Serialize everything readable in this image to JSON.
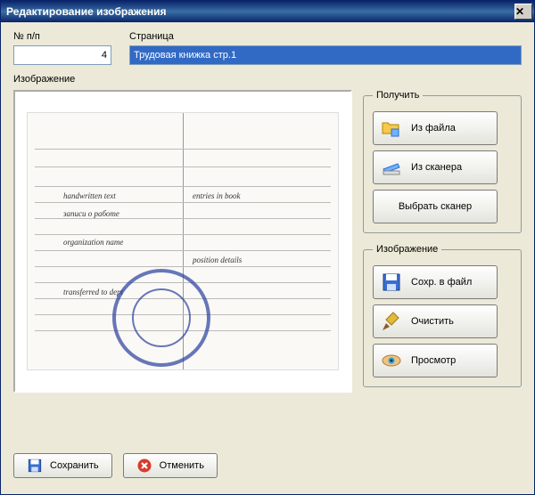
{
  "window": {
    "title": "Редактирование изображения"
  },
  "fields": {
    "number_label": "№ п/п",
    "number_value": "4",
    "page_label": "Страница",
    "page_value": "Трудовая книжка стр.1",
    "image_label": "Изображение"
  },
  "groups": {
    "get": "Получить",
    "image": "Изображение"
  },
  "buttons": {
    "from_file": "Из файла",
    "from_scanner": "Из сканера",
    "choose_scanner": "Выбрать сканер",
    "save_to_file": "Сохр. в файл",
    "clear": "Очистить",
    "preview": "Просмотр",
    "save": "Сохранить",
    "cancel": "Отменить"
  }
}
